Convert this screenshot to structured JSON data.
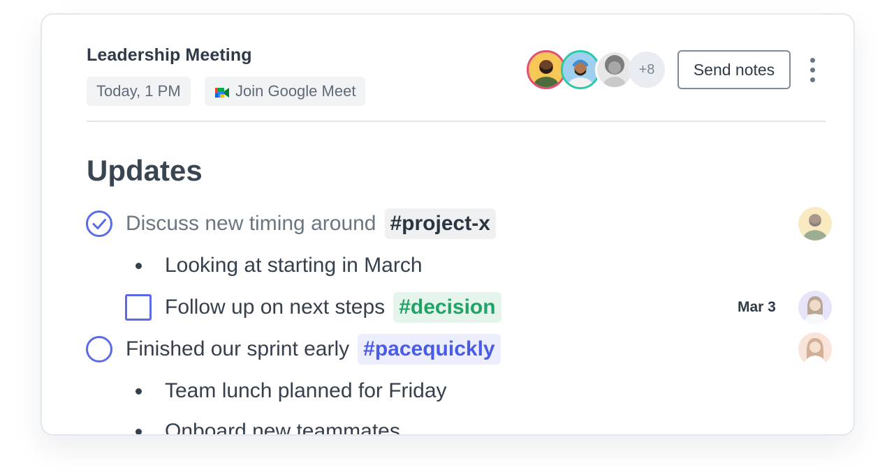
{
  "meeting": {
    "title": "Leadership Meeting",
    "time": "Today, 1 PM",
    "join_label": "Join Google Meet",
    "attendees_more": "+8",
    "send_notes_label": "Send notes"
  },
  "section": {
    "title": "Updates"
  },
  "items": [
    {
      "type": "circle-checked",
      "text": "Discuss new timing around",
      "tag": "#project-x"
    },
    {
      "type": "bullet",
      "text": "Looking at starting in March"
    },
    {
      "type": "checkbox",
      "text": "Follow up on next steps",
      "tag": "#decision",
      "due": "Mar 3"
    },
    {
      "type": "circle",
      "text": "Finished our sprint early",
      "tag": "#pacequickly"
    },
    {
      "type": "bullet",
      "text": "Team lunch planned for Friday"
    },
    {
      "type": "bullet",
      "text": "Onboard new teammates"
    }
  ],
  "colors": {
    "accent": "#5a6ae8",
    "tag_green": "#21a266",
    "tag_blue": "#4a5ce6",
    "avatar_ring_1": "#e44d73",
    "avatar_ring_2": "#29c9a4"
  },
  "icons": {
    "meet": "google-meet-icon",
    "more": "more-vertical-icon",
    "check": "check-circle-icon",
    "circle": "empty-circle-icon",
    "checkbox": "checkbox-icon"
  }
}
